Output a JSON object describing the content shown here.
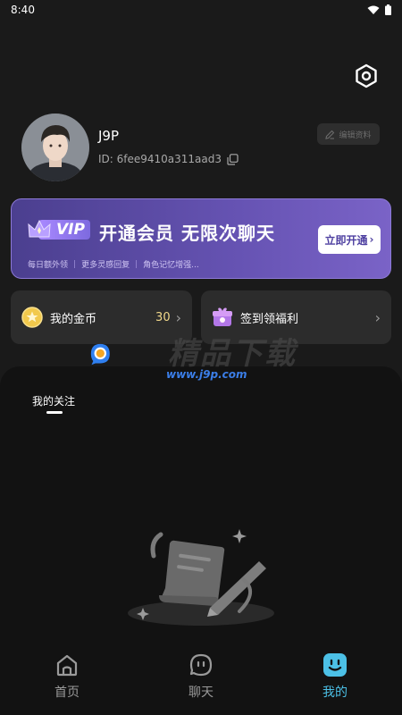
{
  "status_bar": {
    "time": "8:40"
  },
  "profile": {
    "username": "J9P",
    "user_id": "ID: 6fee9410a311aad3",
    "edit_label": "编辑资料"
  },
  "vip": {
    "badge": "VIP",
    "title": "开通会员 无限次聊天",
    "button_label": "立即开通",
    "perks": [
      "每日额外领",
      "更多灵感回复",
      "角色记忆增强..."
    ],
    "separator": "|"
  },
  "coins": {
    "label": "我的金币",
    "value": "30"
  },
  "signin": {
    "label": "签到领福利"
  },
  "tabs": {
    "follow_label": "我的关注"
  },
  "watermark": {
    "url": "www.j9p.com",
    "brand": "精品下载"
  },
  "nav": {
    "items": [
      {
        "label": "首页",
        "icon": "home-icon"
      },
      {
        "label": "聊天",
        "icon": "chat-icon"
      },
      {
        "label": "我的",
        "icon": "profile-smile-icon",
        "active": true
      }
    ]
  },
  "colors": {
    "accent": "#4cc0e6",
    "vip_gradient_start": "#4b3f8f",
    "vip_gradient_end": "#7a63c7",
    "coin": "#f0d78a"
  }
}
